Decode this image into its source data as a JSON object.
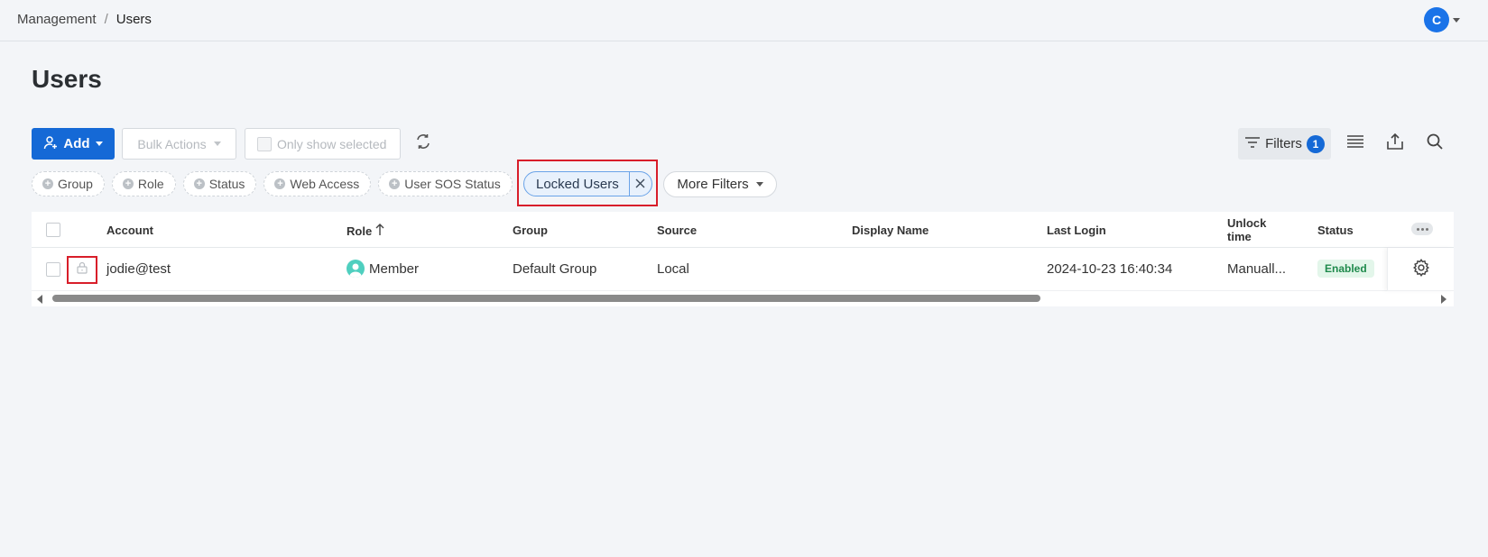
{
  "breadcrumb": {
    "parent": "Management",
    "separator": "/",
    "current": "Users"
  },
  "user_menu": {
    "avatar_initial": "C"
  },
  "page": {
    "title": "Users"
  },
  "toolbar": {
    "add_label": "Add",
    "bulk_actions_label": "Bulk Actions",
    "only_selected_label": "Only show selected",
    "filters_label": "Filters",
    "filters_count": "1"
  },
  "filter_chips": [
    {
      "label": "Group"
    },
    {
      "label": "Role"
    },
    {
      "label": "Status"
    },
    {
      "label": "Web Access"
    },
    {
      "label": "User SOS Status"
    }
  ],
  "active_filter": {
    "label": "Locked Users"
  },
  "more_filters_label": "More Filters",
  "table": {
    "columns": {
      "account": "Account",
      "role": "Role",
      "group": "Group",
      "source": "Source",
      "display_name": "Display Name",
      "last_login": "Last Login",
      "unlock_time_line1": "Unlock",
      "unlock_time_line2": "time",
      "status": "Status"
    },
    "rows": [
      {
        "account": "jodie@test",
        "role": "Member",
        "group": "Default Group",
        "source": "Local",
        "display_name": "",
        "last_login": "2024-10-23 16:40:34",
        "unlock_time": "Manuall...",
        "status": "Enabled"
      }
    ]
  },
  "colors": {
    "primary": "#1569d6",
    "highlight_border": "#d81e2a",
    "status_enabled_bg": "#e3f6ea",
    "status_enabled_text": "#1f8a4c",
    "role_avatar": "#4fcfbf"
  },
  "icons": [
    "add-user-icon",
    "refresh-icon",
    "filter-icon",
    "columns-icon",
    "export-icon",
    "search-icon",
    "lock-icon",
    "close-icon",
    "gear-icon",
    "more-icon",
    "sort-asc-icon"
  ]
}
